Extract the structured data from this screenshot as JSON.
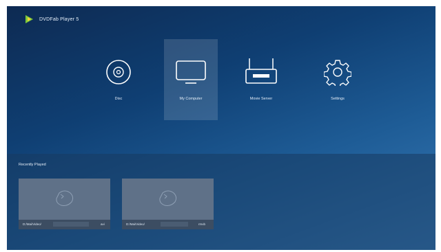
{
  "app": {
    "title": "DVDFab Player 5"
  },
  "menu": {
    "items": [
      {
        "label": "Disc",
        "icon": "disc-icon"
      },
      {
        "label": "My Computer",
        "icon": "monitor-icon",
        "selected": true
      },
      {
        "label": "Movie Server",
        "icon": "router-icon"
      },
      {
        "label": "Settings",
        "icon": "gear-icon"
      }
    ]
  },
  "recent": {
    "title": "Recently Played",
    "items": [
      {
        "path": "D:/Mai/Video/",
        "ext": "avi",
        "icon": "broken-file-icon"
      },
      {
        "path": "D:/Mai/Video/",
        "ext": "rmvb",
        "icon": "broken-file-icon"
      }
    ]
  },
  "colors": {
    "accent": "#7ec93a",
    "background_top": "#0d2a52",
    "background_bottom": "#3a7cb8"
  }
}
